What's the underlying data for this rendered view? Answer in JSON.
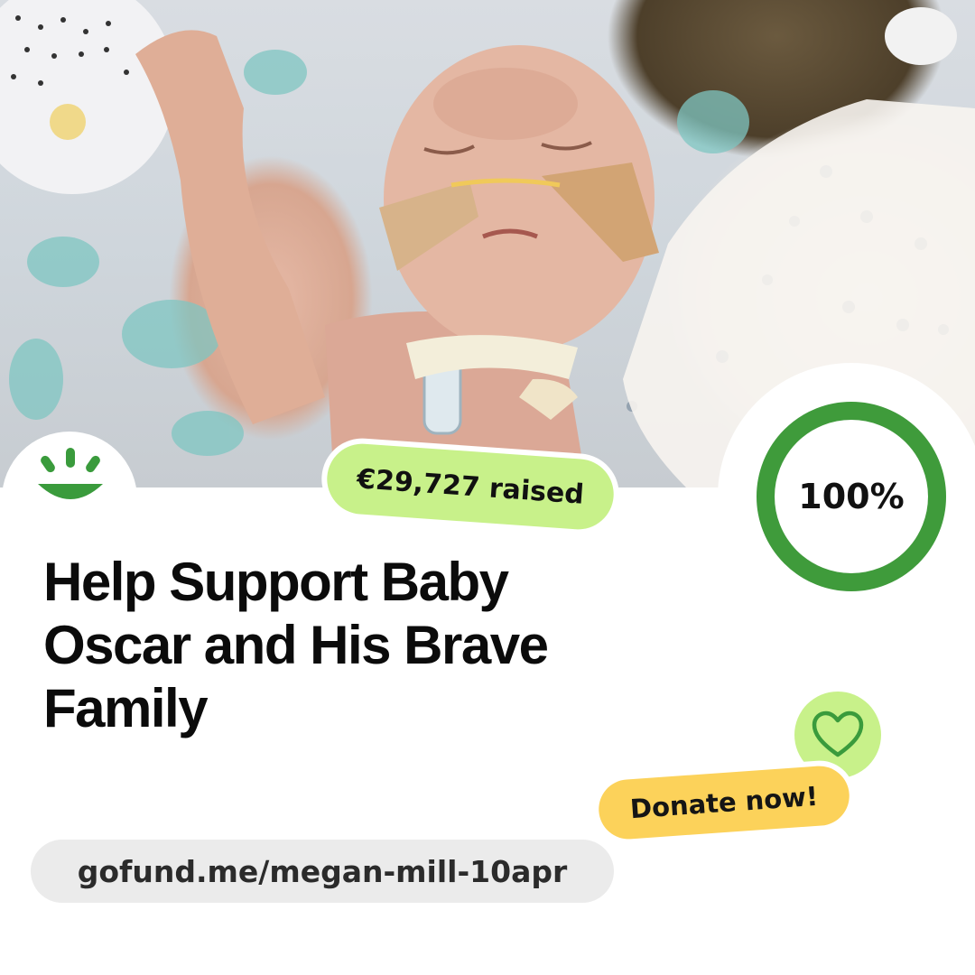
{
  "campaign": {
    "raised_label": "€29,727 raised",
    "progress_percent": 100,
    "progress_label": "100%",
    "title_lines": [
      "Help Support Baby",
      "Oscar and His Brave",
      "Family"
    ],
    "cta_label": "Donate now!",
    "url": "gofund.me/megan-mill-10apr"
  },
  "icons": {
    "logo": "gofundme-sun-logo-icon",
    "heart": "heart-icon"
  },
  "colors": {
    "brand_green": "#3a9b3c",
    "ring_green": "#3f9b3b",
    "raised_pill": "#c8f18a",
    "heart_badge": "#c8f18a",
    "donate_pill": "#fcd25a",
    "url_pill": "#ebebeb"
  },
  "photo": {
    "alt": "Baby in a hospital crib with medical tubes"
  }
}
